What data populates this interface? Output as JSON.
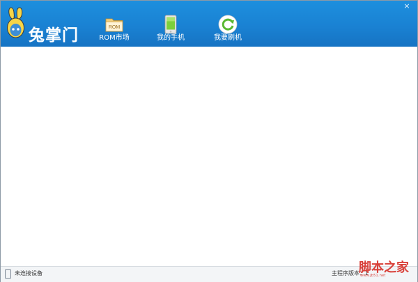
{
  "window": {
    "close_label": "×"
  },
  "header": {
    "logo_text": "兔掌门",
    "nav": [
      {
        "label": "ROM市场",
        "icon": "rom-folder-icon",
        "badge": "ROM"
      },
      {
        "label": "我的手机",
        "icon": "phone-icon"
      },
      {
        "label": "我要刷机",
        "icon": "refresh-icon"
      }
    ]
  },
  "status": {
    "connection": "未连接设备",
    "version_label": "主程序版本：1"
  },
  "watermark": {
    "main": "脚本之家",
    "sub": "www.jb51.net"
  },
  "colors": {
    "header": "#1a82d3",
    "accent_green": "#5bb832",
    "watermark": "#d9413a"
  }
}
